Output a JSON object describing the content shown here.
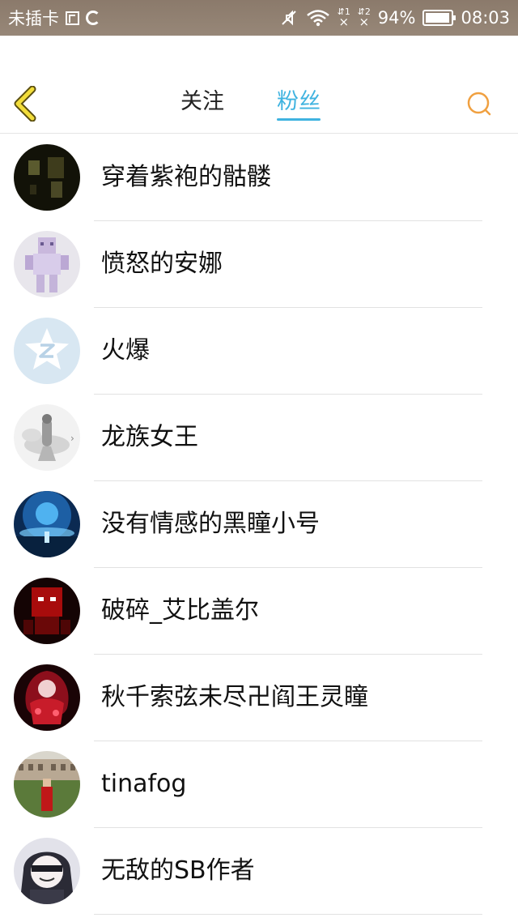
{
  "status_bar": {
    "carrier": "未插卡",
    "sim1_label": "⇵1",
    "sim2_label": "⇵2",
    "battery": "94%",
    "battery_level": 0.94,
    "time": "08:03"
  },
  "header": {
    "tabs": [
      {
        "label": "关注",
        "active": false
      },
      {
        "label": "粉丝",
        "active": true
      }
    ],
    "accent_color": "#3fb3e0",
    "back_icon": "chevron-left-icon",
    "search_icon": "search-icon"
  },
  "fans": [
    {
      "name": "穿着紫袍的骷髅"
    },
    {
      "name": "愤怒的安娜"
    },
    {
      "name": "火爆"
    },
    {
      "name": "龙族女王"
    },
    {
      "name": "没有情感的黑瞳小号"
    },
    {
      "name": "破碎_艾比盖尔"
    },
    {
      "name": "秋千索弦未尽卍阎王灵瞳"
    },
    {
      "name": "tinafog"
    },
    {
      "name": "无敌的SB作者"
    }
  ]
}
